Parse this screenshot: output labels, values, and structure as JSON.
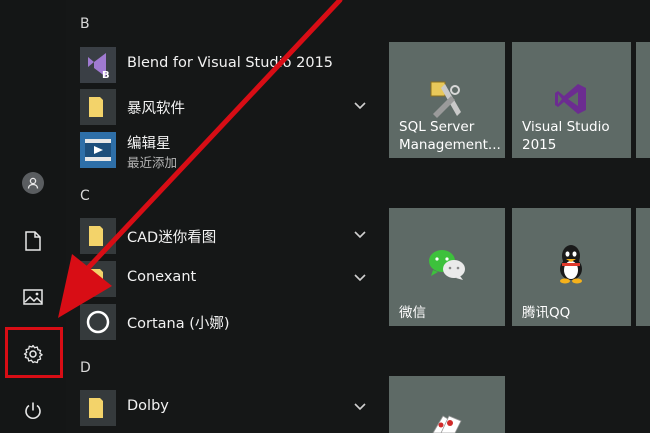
{
  "applist": {
    "letters": {
      "b": "B",
      "c": "C",
      "d": "D"
    },
    "apps": [
      {
        "name": "Blend for Visual Studio 2015"
      },
      {
        "name": "暴风软件"
      },
      {
        "name": "编辑星",
        "sub": "最近添加"
      },
      {
        "name": "CAD迷你看图"
      },
      {
        "name": "Conexant"
      },
      {
        "name": "Cortana (小娜)"
      },
      {
        "name": "Dolby"
      }
    ]
  },
  "tiles": {
    "sql": {
      "line1": "SQL Server",
      "line2": "Management..."
    },
    "vs": {
      "line1": "Visual Studio",
      "line2": "2015"
    },
    "wechat": {
      "label": "微信"
    },
    "qq": {
      "label": "腾讯QQ"
    }
  },
  "colors": {
    "accent_red": "#d80d15",
    "tile": "#5e6a66",
    "folder": "#f3d36a",
    "vs_purple": "#6c2c91"
  },
  "icons": {
    "user": "user-icon",
    "documents": "document-icon",
    "pictures": "picture-icon",
    "settings": "gear-icon",
    "power": "power-icon"
  }
}
